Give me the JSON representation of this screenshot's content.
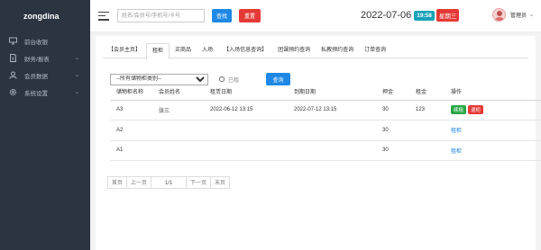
{
  "sidebar": {
    "brand": "zongdina",
    "items": [
      {
        "label": "前台收银",
        "icon": "monitor-icon",
        "has_children": false
      },
      {
        "label": "财务/报表",
        "icon": "file-icon",
        "has_children": true
      },
      {
        "label": "会员数据",
        "icon": "user-icon",
        "has_children": true
      },
      {
        "label": "系统设置",
        "icon": "gear-icon",
        "has_children": true
      }
    ]
  },
  "header": {
    "search_placeholder": "姓名/会员号/手机号/卡号",
    "search_label": "查找",
    "reset_label": "重置",
    "date": "2022-07-06",
    "time": "19:58",
    "weekday": "星期三",
    "username": "管理员"
  },
  "tabs": [
    "【会员主页】",
    "租柜",
    "买商品",
    "入场",
    "【入场信息查询】",
    "团课预约查询",
    "私教预约查询",
    "订单查询"
  ],
  "active_tab": 1,
  "filter": {
    "type_select": "--所有储物柜类别--",
    "rented_label": "已租",
    "query_label": "查询"
  },
  "table": {
    "headers": [
      "储物柜名称",
      "会员姓名",
      "租赁日期",
      "到期日期",
      "押金",
      "租金",
      "操作"
    ],
    "rows": [
      {
        "name": "A3",
        "member": "张三",
        "start": "2022-06-12 13:15",
        "end": "2022-07-12 13:15",
        "deposit": "30",
        "rent": "123",
        "actions": [
          "续租",
          "退柜"
        ]
      },
      {
        "name": "A2",
        "member": "",
        "start": "",
        "end": "",
        "deposit": "30",
        "rent": "",
        "actions": [
          "租柜"
        ]
      },
      {
        "name": "A1",
        "member": "",
        "start": "",
        "end": "",
        "deposit": "30",
        "rent": "",
        "actions": [
          "租柜"
        ]
      }
    ]
  },
  "pager": {
    "first": "首页",
    "prev": "上一页",
    "page": "1/1",
    "next": "下一页",
    "last": "末页"
  },
  "colors": {
    "sidebar_bg": "#2b3441",
    "primary": "#1e88e5",
    "danger": "#e53935",
    "success": "#28a745",
    "time_badge": "#17a2b8"
  }
}
